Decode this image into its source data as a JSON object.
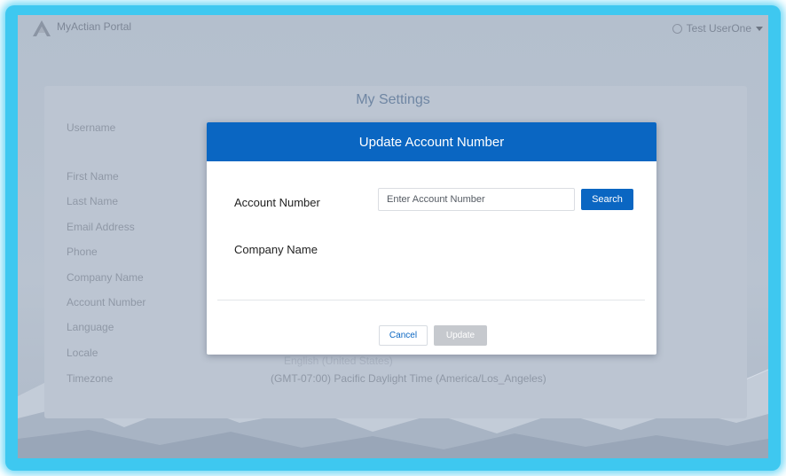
{
  "app": {
    "title": "MyActian Portal",
    "user_name": "Test UserOne"
  },
  "settings": {
    "title": "My Settings",
    "fields": [
      "Username",
      "First Name",
      "Last Name",
      "Email Address",
      "Phone",
      "Company Name",
      "Account Number",
      "Language",
      "Locale",
      "Timezone"
    ],
    "locale_value": "English (United States)",
    "timezone_value": "(GMT-07:00) Pacific Daylight Time (America/Los_Angeles)"
  },
  "modal": {
    "title": "Update Account Number",
    "account_number_label": "Account Number",
    "account_number_placeholder": "Enter Account Number",
    "account_number_value": "",
    "search_label": "Search",
    "company_name_label": "Company Name",
    "cancel_label": "Cancel",
    "update_label": "Update",
    "update_enabled": false
  },
  "colors": {
    "primary": "#0a66c2",
    "glow": "#3ec8f0",
    "disabled": "#c6c9ce"
  },
  "icons": {
    "logo": "actian-logo-icon",
    "user": "user-circle-icon",
    "dropdown": "caret-down-icon"
  }
}
